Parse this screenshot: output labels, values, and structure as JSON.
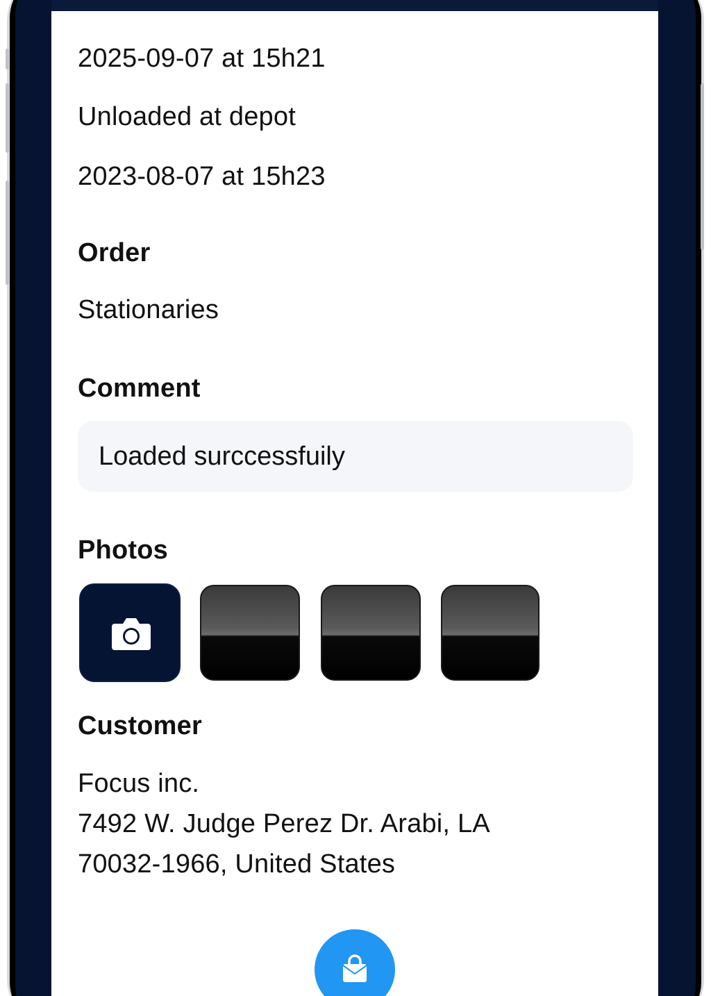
{
  "history": {
    "date_1": "2025-09-07 at 15h21",
    "status": "Unloaded at depot",
    "date_2": "2023-08-07 at 15h23"
  },
  "order": {
    "heading": "Order",
    "value": "Stationaries"
  },
  "comment": {
    "heading": "Comment",
    "value": "Loaded surccessfuily"
  },
  "photos": {
    "heading": "Photos",
    "add_icon": "camera-icon",
    "thumbnail_count": 3
  },
  "customer": {
    "heading": "Customer",
    "name": "Focus inc.",
    "address_line_1": "7492 W. Judge Perez Dr. Arabi, LA",
    "address_line_2": "70032-1966, United States"
  },
  "fab": {
    "icon": "shopping-bag-icon",
    "color": "#2196f3"
  },
  "colors": {
    "header_navy": "#0b1a3a",
    "camera_button": "#051432",
    "comment_bg": "#f4f6fa"
  }
}
